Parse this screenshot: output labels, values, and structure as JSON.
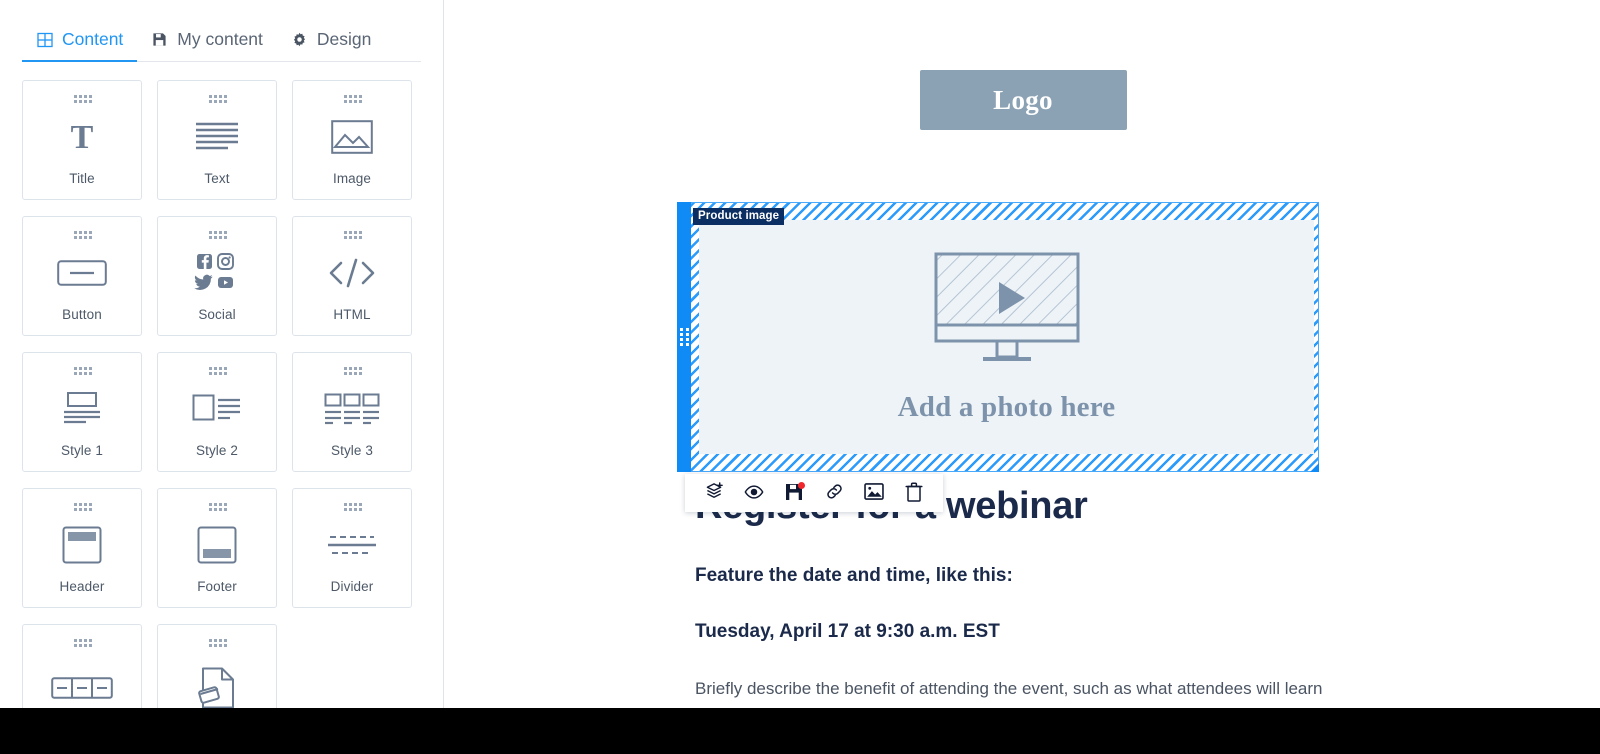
{
  "sidebar": {
    "tabs": [
      {
        "label": "Content",
        "icon": "grid-icon",
        "active": true
      },
      {
        "label": "My content",
        "icon": "save-icon",
        "active": false
      },
      {
        "label": "Design",
        "icon": "gear-icon",
        "active": false
      }
    ],
    "blocks": [
      {
        "label": "Title",
        "icon": "title-icon"
      },
      {
        "label": "Text",
        "icon": "text-lines-icon"
      },
      {
        "label": "Image",
        "icon": "image-icon"
      },
      {
        "label": "Button",
        "icon": "button-icon"
      },
      {
        "label": "Social",
        "icon": "social-icons"
      },
      {
        "label": "HTML",
        "icon": "code-icon"
      },
      {
        "label": "Style 1",
        "icon": "style-1-icon"
      },
      {
        "label": "Style 2",
        "icon": "style-2-icon"
      },
      {
        "label": "Style 3",
        "icon": "style-3-icon"
      },
      {
        "label": "Header",
        "icon": "header-icon"
      },
      {
        "label": "Footer",
        "icon": "footer-icon"
      },
      {
        "label": "Divider",
        "icon": "divider-icon"
      },
      {
        "label": "",
        "icon": "columns-icon"
      },
      {
        "label": "",
        "icon": "file-card-icon"
      }
    ]
  },
  "email": {
    "logo_text": "Logo",
    "selection": {
      "tag": "Product image",
      "placeholder_text": "Add a photo here"
    },
    "toolbar": [
      {
        "name": "duplicate-block-button",
        "icon": "add-layer-icon",
        "badge": false
      },
      {
        "name": "preview-button",
        "icon": "eye-icon",
        "badge": false
      },
      {
        "name": "save-block-button",
        "icon": "save-disk-icon",
        "badge": true
      },
      {
        "name": "link-button",
        "icon": "link-icon",
        "badge": false
      },
      {
        "name": "replace-image-button",
        "icon": "image-icon",
        "badge": false
      },
      {
        "name": "delete-block-button",
        "icon": "trash-icon",
        "badge": false
      }
    ],
    "heading": "Register for a webinar",
    "subheading": "Feature the date and time, like this:",
    "date_time": "Tuesday, April 17 at 9:30 a.m. EST",
    "body": "Briefly describe the benefit of attending the event, such as what attendees will learn"
  },
  "colors": {
    "accent": "#2196f3",
    "selection_blue": "#108bf5",
    "tag_navy": "#0b2e63",
    "logo_bg": "#8ba2b5",
    "placeholder_text": "#7d93ab",
    "badge_red": "#f0282d",
    "heading": "#1b2a4a"
  }
}
